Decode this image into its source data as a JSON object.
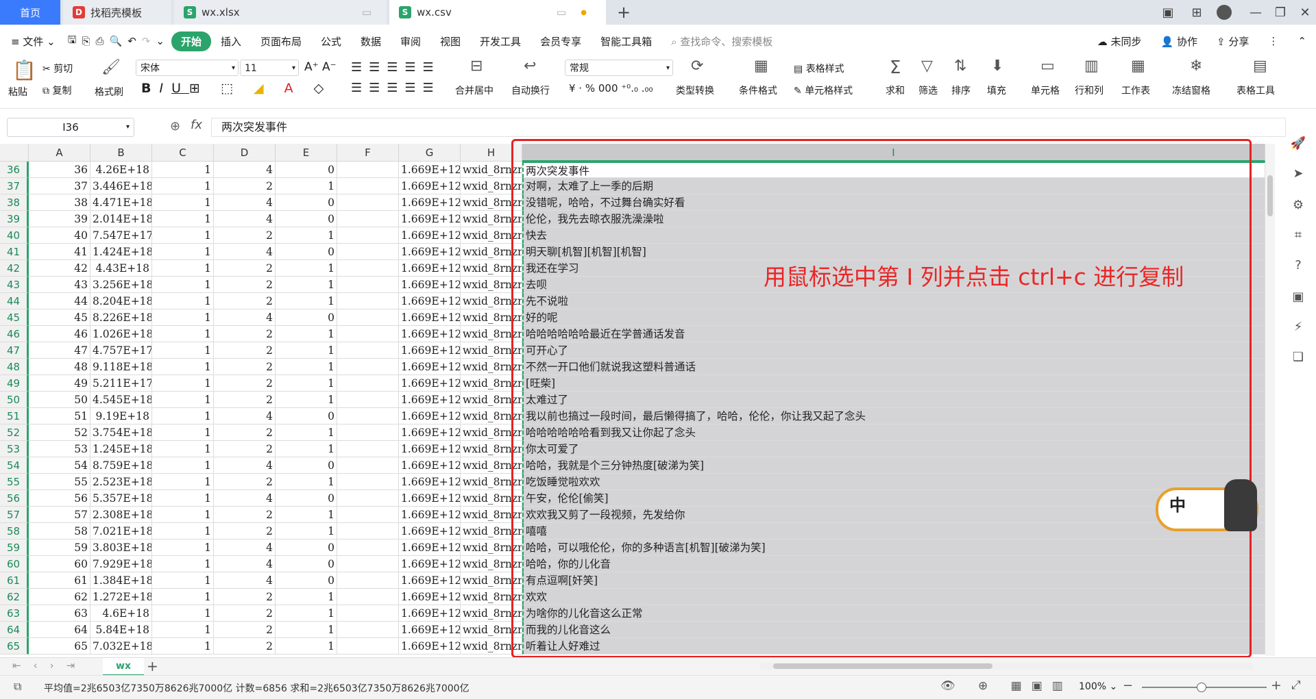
{
  "tabs": {
    "home": "首页",
    "template": "找稻壳模板",
    "xlsx": "wx.xlsx",
    "csv": "wx.csv"
  },
  "menubar": {
    "file": "文件",
    "items": [
      "开始",
      "插入",
      "页面布局",
      "公式",
      "数据",
      "审阅",
      "视图",
      "开发工具",
      "会员专享",
      "智能工具箱"
    ],
    "search_placeholder": "查找命令、搜索模板",
    "unsynced": "未同步",
    "collab": "协作",
    "share": "分享"
  },
  "ribbon": {
    "paste": "粘贴",
    "cut": "剪切",
    "copy": "复制",
    "format_painter": "格式刷",
    "font_name": "宋体",
    "font_size": "11",
    "merge_center": "合并居中",
    "wrap_text": "自动换行",
    "number_format": "常规",
    "type_convert": "类型转换",
    "cond_format": "条件格式",
    "table_style": "表格样式",
    "cell_style": "单元格样式",
    "sum": "求和",
    "filter": "筛选",
    "sort": "排序",
    "fill": "填充",
    "cell": "单元格",
    "row_col": "行和列",
    "worksheet": "工作表",
    "freeze": "冻结窗格",
    "table_tools": "表格工具",
    "sum_icon": "Σ"
  },
  "formula": {
    "cell_ref": "I36",
    "fx_label": "fx",
    "content": "两次突发事件"
  },
  "columns": [
    "A",
    "B",
    "C",
    "D",
    "E",
    "F",
    "G",
    "H",
    "I"
  ],
  "rows": [
    {
      "n": "36",
      "a": "36",
      "b": "4.26E+18",
      "c": "1",
      "d": "4",
      "e": "0",
      "g": "1.669E+12",
      "h": "wxid_8rnzn",
      "i": "两次突发事件"
    },
    {
      "n": "37",
      "a": "37",
      "b": "3.446E+18",
      "c": "1",
      "d": "2",
      "e": "1",
      "g": "1.669E+12",
      "h": "wxid_8rnzn",
      "i": "对啊，太难了上一季的后期"
    },
    {
      "n": "38",
      "a": "38",
      "b": "4.471E+18",
      "c": "1",
      "d": "4",
      "e": "0",
      "g": "1.669E+12",
      "h": "wxid_8rnzn",
      "i": "没错呢，哈哈，不过舞台确实好看"
    },
    {
      "n": "39",
      "a": "39",
      "b": "2.014E+18",
      "c": "1",
      "d": "4",
      "e": "0",
      "g": "1.669E+12",
      "h": "wxid_8rnzn",
      "i": "伦伦，我先去晾衣服洗澡澡啦"
    },
    {
      "n": "40",
      "a": "40",
      "b": "7.547E+17",
      "c": "1",
      "d": "2",
      "e": "1",
      "g": "1.669E+12",
      "h": "wxid_8rnzn",
      "i": "快去"
    },
    {
      "n": "41",
      "a": "41",
      "b": "1.424E+18",
      "c": "1",
      "d": "4",
      "e": "0",
      "g": "1.669E+12",
      "h": "wxid_8rnzn",
      "i": "明天聊[机智][机智][机智]"
    },
    {
      "n": "42",
      "a": "42",
      "b": "4.43E+18",
      "c": "1",
      "d": "2",
      "e": "1",
      "g": "1.669E+12",
      "h": "wxid_8rnzn",
      "i": "我还在学习"
    },
    {
      "n": "43",
      "a": "43",
      "b": "3.256E+18",
      "c": "1",
      "d": "2",
      "e": "1",
      "g": "1.669E+12",
      "h": "wxid_8rnzn",
      "i": "去呗"
    },
    {
      "n": "44",
      "a": "44",
      "b": "8.204E+18",
      "c": "1",
      "d": "2",
      "e": "1",
      "g": "1.669E+12",
      "h": "wxid_8rnzn",
      "i": "先不说啦"
    },
    {
      "n": "45",
      "a": "45",
      "b": "8.226E+18",
      "c": "1",
      "d": "4",
      "e": "0",
      "g": "1.669E+12",
      "h": "wxid_8rnzn",
      "i": "好的呢"
    },
    {
      "n": "46",
      "a": "46",
      "b": "1.026E+18",
      "c": "1",
      "d": "2",
      "e": "1",
      "g": "1.669E+12",
      "h": "wxid_8rnzn",
      "i": "哈哈哈哈哈哈最近在学普通话发音"
    },
    {
      "n": "47",
      "a": "47",
      "b": "4.757E+17",
      "c": "1",
      "d": "2",
      "e": "1",
      "g": "1.669E+12",
      "h": "wxid_8rnzn",
      "i": "可开心了"
    },
    {
      "n": "48",
      "a": "48",
      "b": "9.118E+18",
      "c": "1",
      "d": "2",
      "e": "1",
      "g": "1.669E+12",
      "h": "wxid_8rnzn",
      "i": "不然一开口他们就说我这塑料普通话"
    },
    {
      "n": "49",
      "a": "49",
      "b": "5.211E+17",
      "c": "1",
      "d": "2",
      "e": "1",
      "g": "1.669E+12",
      "h": "wxid_8rnzn",
      "i": "[旺柴]"
    },
    {
      "n": "50",
      "a": "50",
      "b": "4.545E+18",
      "c": "1",
      "d": "2",
      "e": "1",
      "g": "1.669E+12",
      "h": "wxid_8rnzn",
      "i": "太难过了"
    },
    {
      "n": "51",
      "a": "51",
      "b": "9.19E+18",
      "c": "1",
      "d": "4",
      "e": "0",
      "g": "1.669E+12",
      "h": "wxid_8rnzn",
      "i": "我以前也搞过一段时间，最后懒得搞了，哈哈，伦伦，你让我又起了念头"
    },
    {
      "n": "52",
      "a": "52",
      "b": "3.754E+18",
      "c": "1",
      "d": "2",
      "e": "1",
      "g": "1.669E+12",
      "h": "wxid_8rnzn",
      "i": "哈哈哈哈哈哈看到我又让你起了念头"
    },
    {
      "n": "53",
      "a": "53",
      "b": "1.245E+18",
      "c": "1",
      "d": "2",
      "e": "1",
      "g": "1.669E+12",
      "h": "wxid_8rnzn",
      "i": "你太可爱了"
    },
    {
      "n": "54",
      "a": "54",
      "b": "8.759E+18",
      "c": "1",
      "d": "4",
      "e": "0",
      "g": "1.669E+12",
      "h": "wxid_8rnzn",
      "i": "哈哈，我就是个三分钟热度[破涕为笑]"
    },
    {
      "n": "55",
      "a": "55",
      "b": "2.523E+18",
      "c": "1",
      "d": "2",
      "e": "1",
      "g": "1.669E+12",
      "h": "wxid_8rnzn",
      "i": "吃饭睡觉啦欢欢"
    },
    {
      "n": "56",
      "a": "56",
      "b": "5.357E+18",
      "c": "1",
      "d": "4",
      "e": "0",
      "g": "1.669E+12",
      "h": "wxid_8rnzn",
      "i": "午安，伦伦[偷笑]"
    },
    {
      "n": "57",
      "a": "57",
      "b": "2.308E+18",
      "c": "1",
      "d": "2",
      "e": "1",
      "g": "1.669E+12",
      "h": "wxid_8rnzn",
      "i": "欢欢我又剪了一段视频，先发给你"
    },
    {
      "n": "58",
      "a": "58",
      "b": "7.021E+18",
      "c": "1",
      "d": "2",
      "e": "1",
      "g": "1.669E+12",
      "h": "wxid_8rnzn",
      "i": "嘻嘻"
    },
    {
      "n": "59",
      "a": "59",
      "b": "3.803E+18",
      "c": "1",
      "d": "4",
      "e": "0",
      "g": "1.669E+12",
      "h": "wxid_8rnzn",
      "i": "哈哈，可以哦伦伦，你的多种语言[机智][破涕为笑]"
    },
    {
      "n": "60",
      "a": "60",
      "b": "7.929E+18",
      "c": "1",
      "d": "4",
      "e": "0",
      "g": "1.669E+12",
      "h": "wxid_8rnzn",
      "i": "哈哈，你的儿化音"
    },
    {
      "n": "61",
      "a": "61",
      "b": "1.384E+18",
      "c": "1",
      "d": "4",
      "e": "0",
      "g": "1.669E+12",
      "h": "wxid_8rnzn",
      "i": "有点逗啊[奸笑]"
    },
    {
      "n": "62",
      "a": "62",
      "b": "1.272E+18",
      "c": "1",
      "d": "2",
      "e": "1",
      "g": "1.669E+12",
      "h": "wxid_8rnzn",
      "i": "欢欢"
    },
    {
      "n": "63",
      "a": "63",
      "b": "4.6E+18",
      "c": "1",
      "d": "2",
      "e": "1",
      "g": "1.669E+12",
      "h": "wxid_8rnzn",
      "i": "为啥你的儿化音这么正常"
    },
    {
      "n": "64",
      "a": "64",
      "b": "5.84E+18",
      "c": "1",
      "d": "2",
      "e": "1",
      "g": "1.669E+12",
      "h": "wxid_8rnzn",
      "i": "而我的儿化音这么"
    },
    {
      "n": "65",
      "a": "65",
      "b": "7.032E+18",
      "c": "1",
      "d": "2",
      "e": "1",
      "g": "1.669E+12",
      "h": "wxid_8rnzn",
      "i": "听着让人好难过"
    }
  ],
  "annotation": "用鼠标选中第 I 列并点击 ctrl+c 进行复制",
  "sheet_tab": "wx",
  "status": {
    "summary": "平均值=2兆6503亿7350万8626兆7000亿  计数=6856  求和=2兆6503亿7350万8626兆7000亿",
    "zoom": "100%"
  },
  "ime_label": "中"
}
